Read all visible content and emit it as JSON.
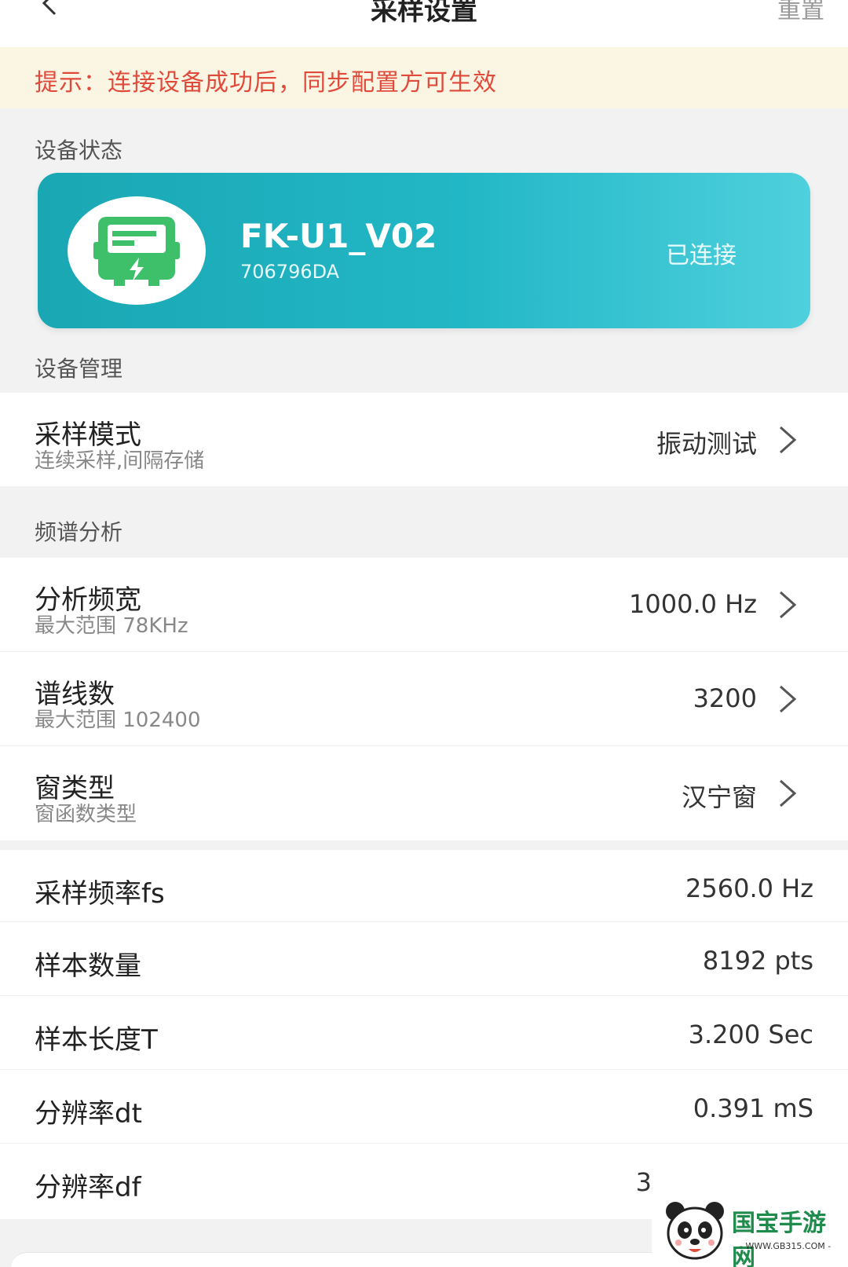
{
  "header": {
    "title": "采样设置",
    "right": "重置"
  },
  "tip": "提示：连接设备成功后，同步配置方可生效",
  "sections": {
    "status": "设备状态",
    "manage": "设备管理",
    "spectrum": "频谱分析"
  },
  "device": {
    "name": "FK-U1_V02",
    "id": "706796DA",
    "status": "已连接",
    "icon": "meter-icon"
  },
  "manage_rows": [
    {
      "title": "采样模式",
      "sub": "连续采样,间隔存储",
      "value": "振动测试"
    }
  ],
  "spectrum_rows": [
    {
      "title": "分析频宽",
      "sub": "最大范围 78KHz",
      "value": "1000.0 Hz"
    },
    {
      "title": "谱线数",
      "sub": "最大范围 102400",
      "value": "3200"
    },
    {
      "title": "窗类型",
      "sub": "窗函数类型",
      "value": "汉宁窗"
    }
  ],
  "info_rows": [
    {
      "title": "采样频率fs",
      "value": "2560.0 Hz"
    },
    {
      "title": "样本数量",
      "value": "8192 pts"
    },
    {
      "title": "样本长度T",
      "value": "3.200 Sec"
    },
    {
      "title": "分辨率dt",
      "value": "0.391 mS"
    },
    {
      "title": "分辨率df",
      "value": "3"
    }
  ],
  "watermark": {
    "brand": "国宝手游网",
    "site": "- WWW.GB315.COM -"
  },
  "colors": {
    "accent": "#1aa7b3",
    "tip_text": "#e04a3b",
    "tip_bg": "#fbf6e4"
  }
}
